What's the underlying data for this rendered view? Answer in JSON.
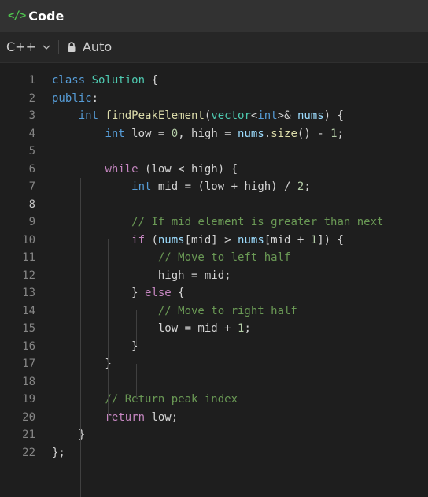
{
  "header": {
    "icon": "code-icon",
    "icon_glyph": "</>",
    "title": "Code"
  },
  "toolbar": {
    "language": "C++",
    "mode": "Auto"
  },
  "editor": {
    "active_line": 8,
    "lines": [
      {
        "n": "1",
        "tokens": [
          [
            "kw",
            "class"
          ],
          [
            "pl",
            " "
          ],
          [
            "ty",
            "Solution"
          ],
          [
            "pl",
            " {"
          ]
        ]
      },
      {
        "n": "2",
        "tokens": [
          [
            "kw",
            "public"
          ],
          [
            "pl",
            ":"
          ]
        ]
      },
      {
        "n": "3",
        "tokens": [
          [
            "pl",
            "    "
          ],
          [
            "kw",
            "int"
          ],
          [
            "pl",
            " "
          ],
          [
            "fn",
            "findPeakElement"
          ],
          [
            "pl",
            "("
          ],
          [
            "ty",
            "vector"
          ],
          [
            "pl",
            "<"
          ],
          [
            "kw",
            "int"
          ],
          [
            "pl",
            ">& "
          ],
          [
            "var",
            "nums"
          ],
          [
            "pl",
            ") {"
          ]
        ]
      },
      {
        "n": "4",
        "tokens": [
          [
            "pl",
            "        "
          ],
          [
            "kw",
            "int"
          ],
          [
            "pl",
            " low = "
          ],
          [
            "num",
            "0"
          ],
          [
            "pl",
            ", high = "
          ],
          [
            "var",
            "nums"
          ],
          [
            "pl",
            "."
          ],
          [
            "fn",
            "size"
          ],
          [
            "pl",
            "() - "
          ],
          [
            "num",
            "1"
          ],
          [
            "pl",
            ";"
          ]
        ]
      },
      {
        "n": "5",
        "tokens": []
      },
      {
        "n": "6",
        "tokens": [
          [
            "pl",
            "        "
          ],
          [
            "cf",
            "while"
          ],
          [
            "pl",
            " (low < high) {"
          ]
        ]
      },
      {
        "n": "7",
        "tokens": [
          [
            "pl",
            "            "
          ],
          [
            "kw",
            "int"
          ],
          [
            "pl",
            " mid = (low + high) / "
          ],
          [
            "num",
            "2"
          ],
          [
            "pl",
            ";"
          ]
        ]
      },
      {
        "n": "8",
        "tokens": []
      },
      {
        "n": "9",
        "tokens": [
          [
            "pl",
            "            "
          ],
          [
            "cm",
            "// If mid element is greater than next"
          ]
        ]
      },
      {
        "n": "10",
        "tokens": [
          [
            "pl",
            "            "
          ],
          [
            "cf",
            "if"
          ],
          [
            "pl",
            " ("
          ],
          [
            "var",
            "nums"
          ],
          [
            "pl",
            "[mid] > "
          ],
          [
            "var",
            "nums"
          ],
          [
            "pl",
            "[mid + "
          ],
          [
            "num",
            "1"
          ],
          [
            "pl",
            "]) {"
          ]
        ]
      },
      {
        "n": "11",
        "tokens": [
          [
            "pl",
            "                "
          ],
          [
            "cm",
            "// Move to left half"
          ]
        ]
      },
      {
        "n": "12",
        "tokens": [
          [
            "pl",
            "                high = mid;"
          ]
        ]
      },
      {
        "n": "13",
        "tokens": [
          [
            "pl",
            "            } "
          ],
          [
            "cf",
            "else"
          ],
          [
            "pl",
            " {"
          ]
        ]
      },
      {
        "n": "14",
        "tokens": [
          [
            "pl",
            "                "
          ],
          [
            "cm",
            "// Move to right half"
          ]
        ]
      },
      {
        "n": "15",
        "tokens": [
          [
            "pl",
            "                low = mid + "
          ],
          [
            "num",
            "1"
          ],
          [
            "pl",
            ";"
          ]
        ]
      },
      {
        "n": "16",
        "tokens": [
          [
            "pl",
            "            }"
          ]
        ]
      },
      {
        "n": "17",
        "tokens": [
          [
            "pl",
            "        }"
          ]
        ]
      },
      {
        "n": "18",
        "tokens": []
      },
      {
        "n": "19",
        "tokens": [
          [
            "pl",
            "        "
          ],
          [
            "cm",
            "// Return peak index"
          ]
        ]
      },
      {
        "n": "20",
        "tokens": [
          [
            "pl",
            "        "
          ],
          [
            "cf",
            "return"
          ],
          [
            "pl",
            " low;"
          ]
        ]
      },
      {
        "n": "21",
        "tokens": [
          [
            "pl",
            "    }"
          ]
        ]
      },
      {
        "n": "22",
        "tokens": [
          [
            "pl",
            "};"
          ]
        ]
      }
    ]
  }
}
